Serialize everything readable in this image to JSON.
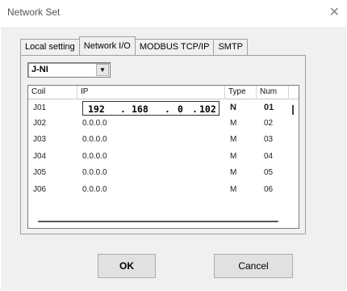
{
  "window": {
    "title": "Network Set",
    "close_glyph": "✕"
  },
  "tabs": [
    {
      "label": "Local setting",
      "active": false
    },
    {
      "label": "Network I/O",
      "active": true
    },
    {
      "label": "MODBUS TCP/IP",
      "active": false
    },
    {
      "label": "SMTP",
      "active": false
    }
  ],
  "device_select": {
    "value": "J-NI",
    "arrow": "▼"
  },
  "table": {
    "columns": [
      "Coil",
      "IP",
      "Type",
      "Num"
    ],
    "rows": [
      {
        "coil": "J01",
        "ip": "192 . 168 . 0 . 102",
        "ip_parts": [
          "192",
          ".",
          "168",
          ".",
          "0",
          ".",
          "102"
        ],
        "type": "N",
        "num": "01",
        "editing": true
      },
      {
        "coil": "J02",
        "ip": "0.0.0.0",
        "type": "M",
        "num": "02"
      },
      {
        "coil": "J03",
        "ip": "0.0.0.0",
        "type": "M",
        "num": "03"
      },
      {
        "coil": "J04",
        "ip": "0.0.0.0",
        "type": "M",
        "num": "04"
      },
      {
        "coil": "J05",
        "ip": "0.0.0.0",
        "type": "M",
        "num": "05"
      },
      {
        "coil": "J06",
        "ip": "0.0.0.0",
        "type": "M",
        "num": "06"
      }
    ]
  },
  "buttons": {
    "ok": "OK",
    "cancel": "Cancel"
  }
}
